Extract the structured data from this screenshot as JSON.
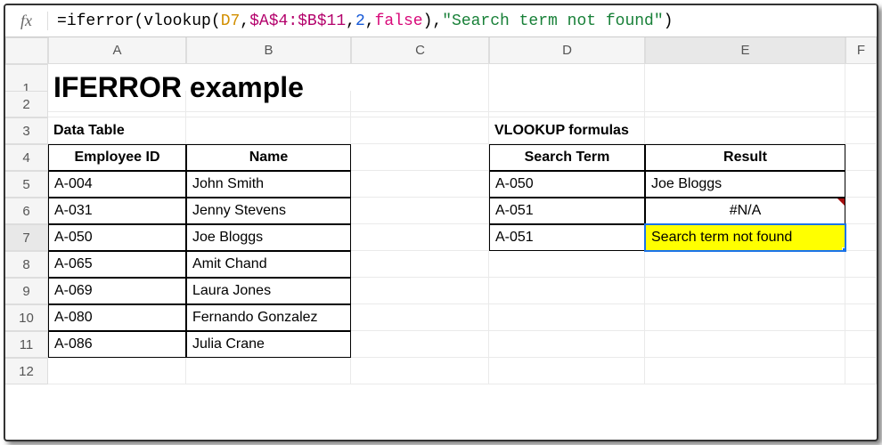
{
  "formula_bar": {
    "fx_label": "fx",
    "eq": "=",
    "fn_iferror": "iferror",
    "fn_vlookup": "vlookup",
    "arg_ref1": "D7",
    "arg_ref2": "$A$4:$B$11",
    "arg_num": "2",
    "arg_bool": "false",
    "arg_str": "\"Search term not found\""
  },
  "columns": [
    "A",
    "B",
    "C",
    "D",
    "E",
    "F"
  ],
  "rows": [
    "1",
    "2",
    "3",
    "4",
    "5",
    "6",
    "7",
    "8",
    "9",
    "10",
    "11",
    "12"
  ],
  "title": "IFERROR example",
  "left": {
    "section_label": "Data Table",
    "col1": "Employee ID",
    "col2": "Name",
    "data": [
      {
        "id": "A-004",
        "name": "John Smith"
      },
      {
        "id": "A-031",
        "name": "Jenny Stevens"
      },
      {
        "id": "A-050",
        "name": "Joe Bloggs"
      },
      {
        "id": "A-065",
        "name": "Amit Chand"
      },
      {
        "id": "A-069",
        "name": "Laura Jones"
      },
      {
        "id": "A-080",
        "name": "Fernando Gonzalez"
      },
      {
        "id": "A-086",
        "name": "Julia Crane"
      }
    ]
  },
  "right": {
    "section_label": "VLOOKUP formulas",
    "col1": "Search Term",
    "col2": "Result",
    "data": [
      {
        "term": "A-050",
        "result": "Joe Bloggs"
      },
      {
        "term": "A-051",
        "result": "#N/A"
      },
      {
        "term": "A-051",
        "result": "Search term not found"
      }
    ]
  },
  "selected_cell_address": "E7"
}
